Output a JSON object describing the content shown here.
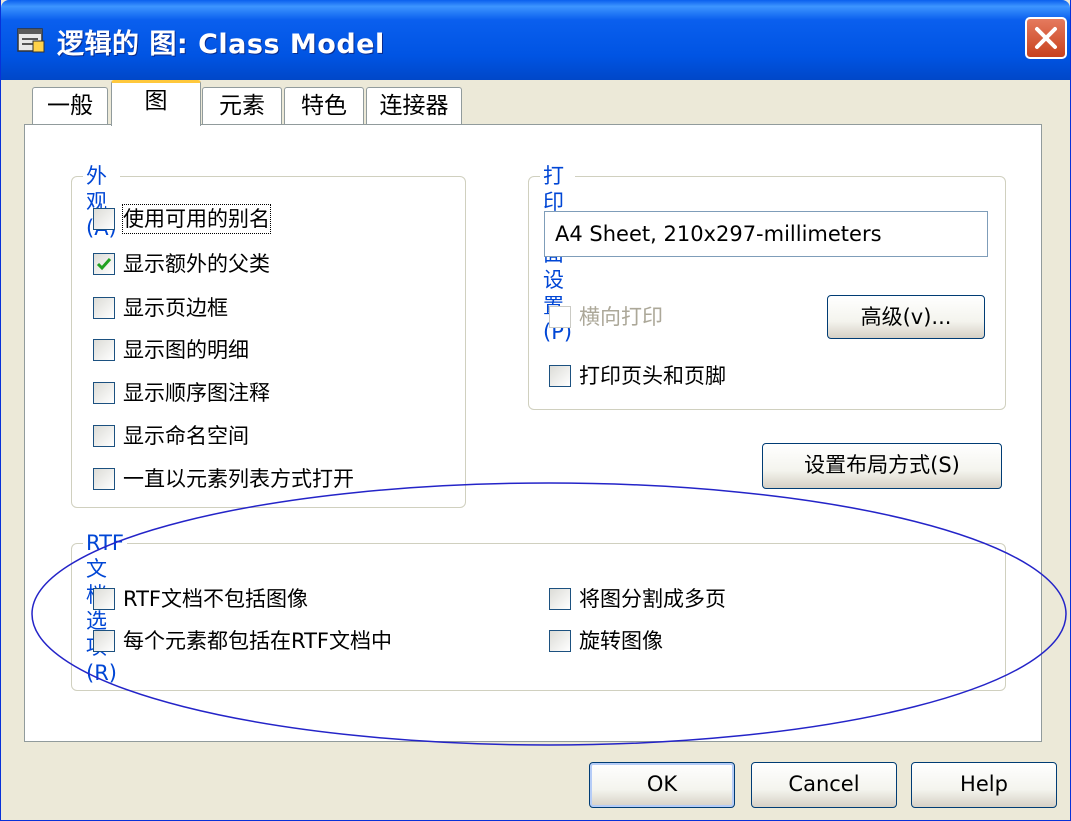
{
  "window": {
    "title": "逻辑的 图: Class Model"
  },
  "tabs": [
    {
      "label": "一般"
    },
    {
      "label": "图"
    },
    {
      "label": "元素"
    },
    {
      "label": "特色"
    },
    {
      "label": "连接器"
    }
  ],
  "appearance": {
    "title": "外观(A)",
    "items": [
      {
        "label": "使用可用的别名",
        "checked": false
      },
      {
        "label": "显示额外的父类",
        "checked": true
      },
      {
        "label": "显示页边框",
        "checked": false
      },
      {
        "label": "显示图的明细",
        "checked": false
      },
      {
        "label": "显示顺序图注释",
        "checked": false
      },
      {
        "label": "显示命名空间",
        "checked": false
      },
      {
        "label": "一直以元素列表方式打开",
        "checked": false
      }
    ]
  },
  "print": {
    "title": "打印页面设置(P)",
    "sheet_value": "A4 Sheet, 210x297-millimeters",
    "landscape_label": "横向打印",
    "landscape_checked": false,
    "advanced_label": "高级(v)...",
    "header_footer_label": "打印页头和页脚",
    "header_footer_checked": false
  },
  "layout_button": {
    "label": "设置布局方式(S)"
  },
  "rtf": {
    "title": "RTF文档选项(R)",
    "items": [
      {
        "label": "RTF文档不包括图像",
        "checked": false
      },
      {
        "label": "每个元素都包括在RTF文档中",
        "checked": false
      },
      {
        "label": "将图分割成多页",
        "checked": false
      },
      {
        "label": "旋转图像",
        "checked": false
      }
    ]
  },
  "footer": {
    "ok_label": "OK",
    "cancel_label": "Cancel",
    "help_label": "Help"
  },
  "colors": {
    "titlebar": "#0054E3",
    "dialog_bg": "#ECE9D8",
    "group_title": "#0046D5",
    "annotation": "#2424C8"
  }
}
